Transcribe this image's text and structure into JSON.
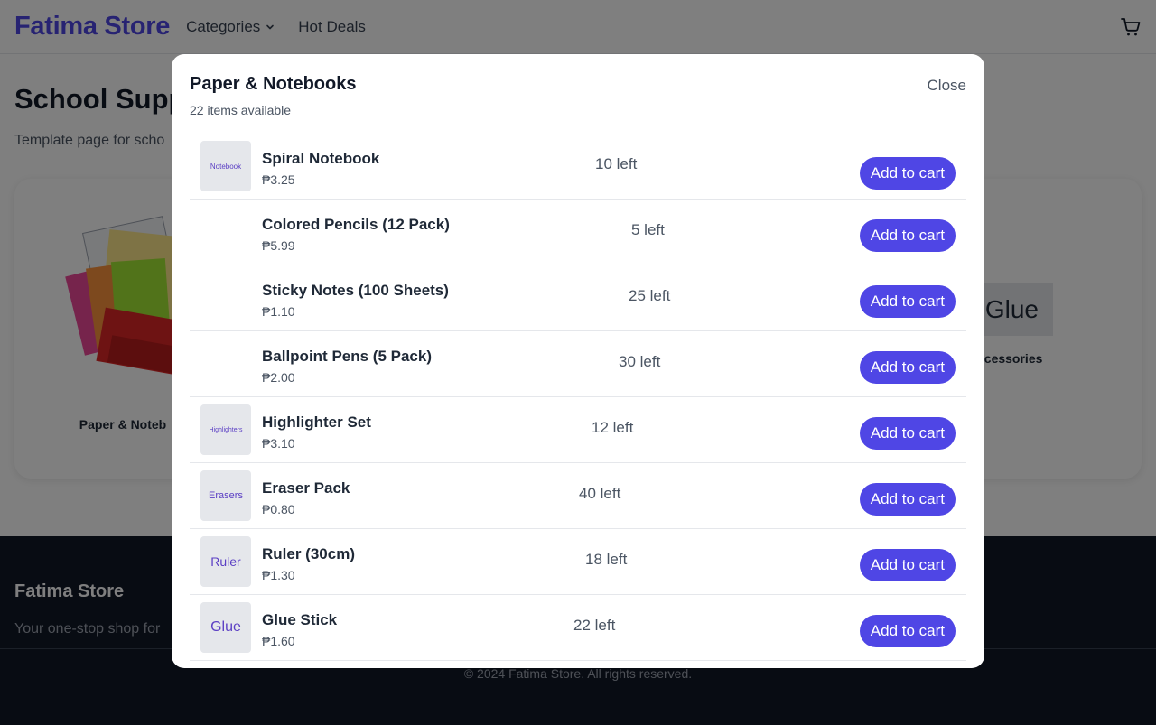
{
  "header": {
    "brand": "Fatima Store",
    "nav": [
      {
        "label": "Categories",
        "icon": "chevron-down-icon"
      },
      {
        "label": "Hot Deals"
      }
    ],
    "cart_icon": "cart-icon"
  },
  "page": {
    "title": "School Supp",
    "subtitle": "Template page for scho"
  },
  "categories": [
    {
      "label": "Paper & Noteb"
    },
    {
      "tile_text": "Glue",
      "label": "ccessories"
    }
  ],
  "footer": {
    "brand": "Fatima Store",
    "tagline": "Your one-stop shop for",
    "copyright": "© 2024 Fatima Store. All rights reserved."
  },
  "modal": {
    "title": "Paper & Notebooks",
    "count": "22 items available",
    "close_label": "Close",
    "add_label": "Add to cart",
    "items": [
      {
        "name": "Spiral Notebook",
        "price": "₱3.25",
        "stock": "10 left",
        "thumb": "Notebook"
      },
      {
        "name": "Colored Pencils (12 Pack)",
        "price": "₱5.99",
        "stock": "5 left",
        "thumb": ""
      },
      {
        "name": "Sticky Notes (100 Sheets)",
        "price": "₱1.10",
        "stock": "25 left",
        "thumb": ""
      },
      {
        "name": "Ballpoint Pens (5 Pack)",
        "price": "₱2.00",
        "stock": "30 left",
        "thumb": ""
      },
      {
        "name": "Highlighter Set",
        "price": "₱3.10",
        "stock": "12 left",
        "thumb": "Highlighters"
      },
      {
        "name": "Eraser Pack",
        "price": "₱0.80",
        "stock": "40 left",
        "thumb": "Erasers"
      },
      {
        "name": "Ruler (30cm)",
        "price": "₱1.30",
        "stock": "18 left",
        "thumb": "Ruler"
      },
      {
        "name": "Glue Stick",
        "price": "₱1.60",
        "stock": "22 left",
        "thumb": "Glue"
      }
    ]
  },
  "colors": {
    "accent": "#4f46e5",
    "thumb_text": "#5b3fc4",
    "footer_bg": "#111827"
  }
}
